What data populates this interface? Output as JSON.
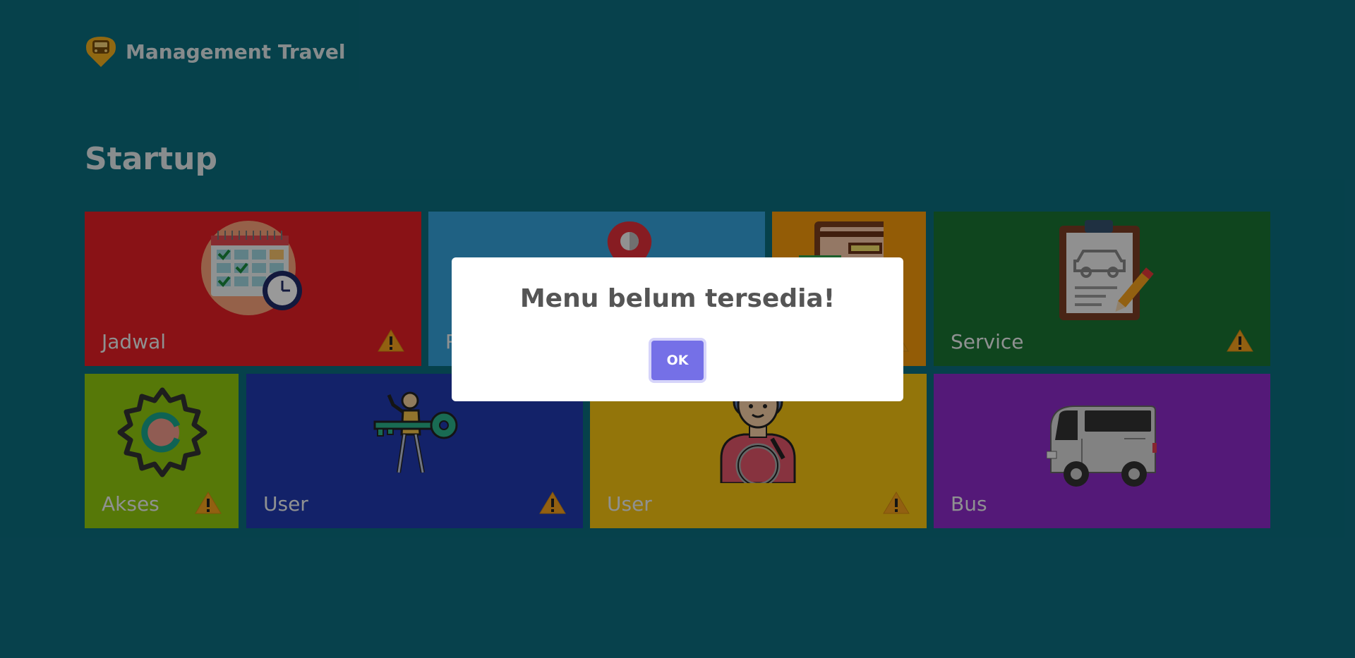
{
  "app": {
    "title": "Management Travel",
    "logo_icon": "bus-pin-logo-icon",
    "brand_color": "#f1ae1e"
  },
  "page": {
    "title": "Startup",
    "background": "#0b6d7e"
  },
  "tiles": [
    {
      "id": "jadwal",
      "label": "Jadwal",
      "color": "#e41e26",
      "icon": "calendar-clock-icon",
      "warning": true
    },
    {
      "id": "rute",
      "label": "R",
      "color": "#35a2db",
      "icon": "map-pin-icon",
      "warning": false
    },
    {
      "id": "tiket",
      "label": "",
      "color": "#f59a0b",
      "icon": "ticket-card-icon",
      "warning": true
    },
    {
      "id": "service",
      "label": "Service",
      "color": "#1a7433",
      "icon": "clipboard-car-icon",
      "warning": true
    },
    {
      "id": "akses",
      "label": "Akses",
      "color": "#90c90e",
      "icon": "gear-icon",
      "warning": true
    },
    {
      "id": "user-access",
      "label": "User",
      "color": "#213ab0",
      "icon": "person-key-icon",
      "warning": true
    },
    {
      "id": "user-driver",
      "label": "User",
      "color": "#f5c312",
      "icon": "driver-icon",
      "warning": true
    },
    {
      "id": "bus",
      "label": "Bus",
      "color": "#8d2ac8",
      "icon": "bus-icon",
      "warning": false
    }
  ],
  "modal": {
    "title": "Menu belum tersedia!",
    "ok_label": "OK",
    "ok_color": "#7570e7"
  }
}
